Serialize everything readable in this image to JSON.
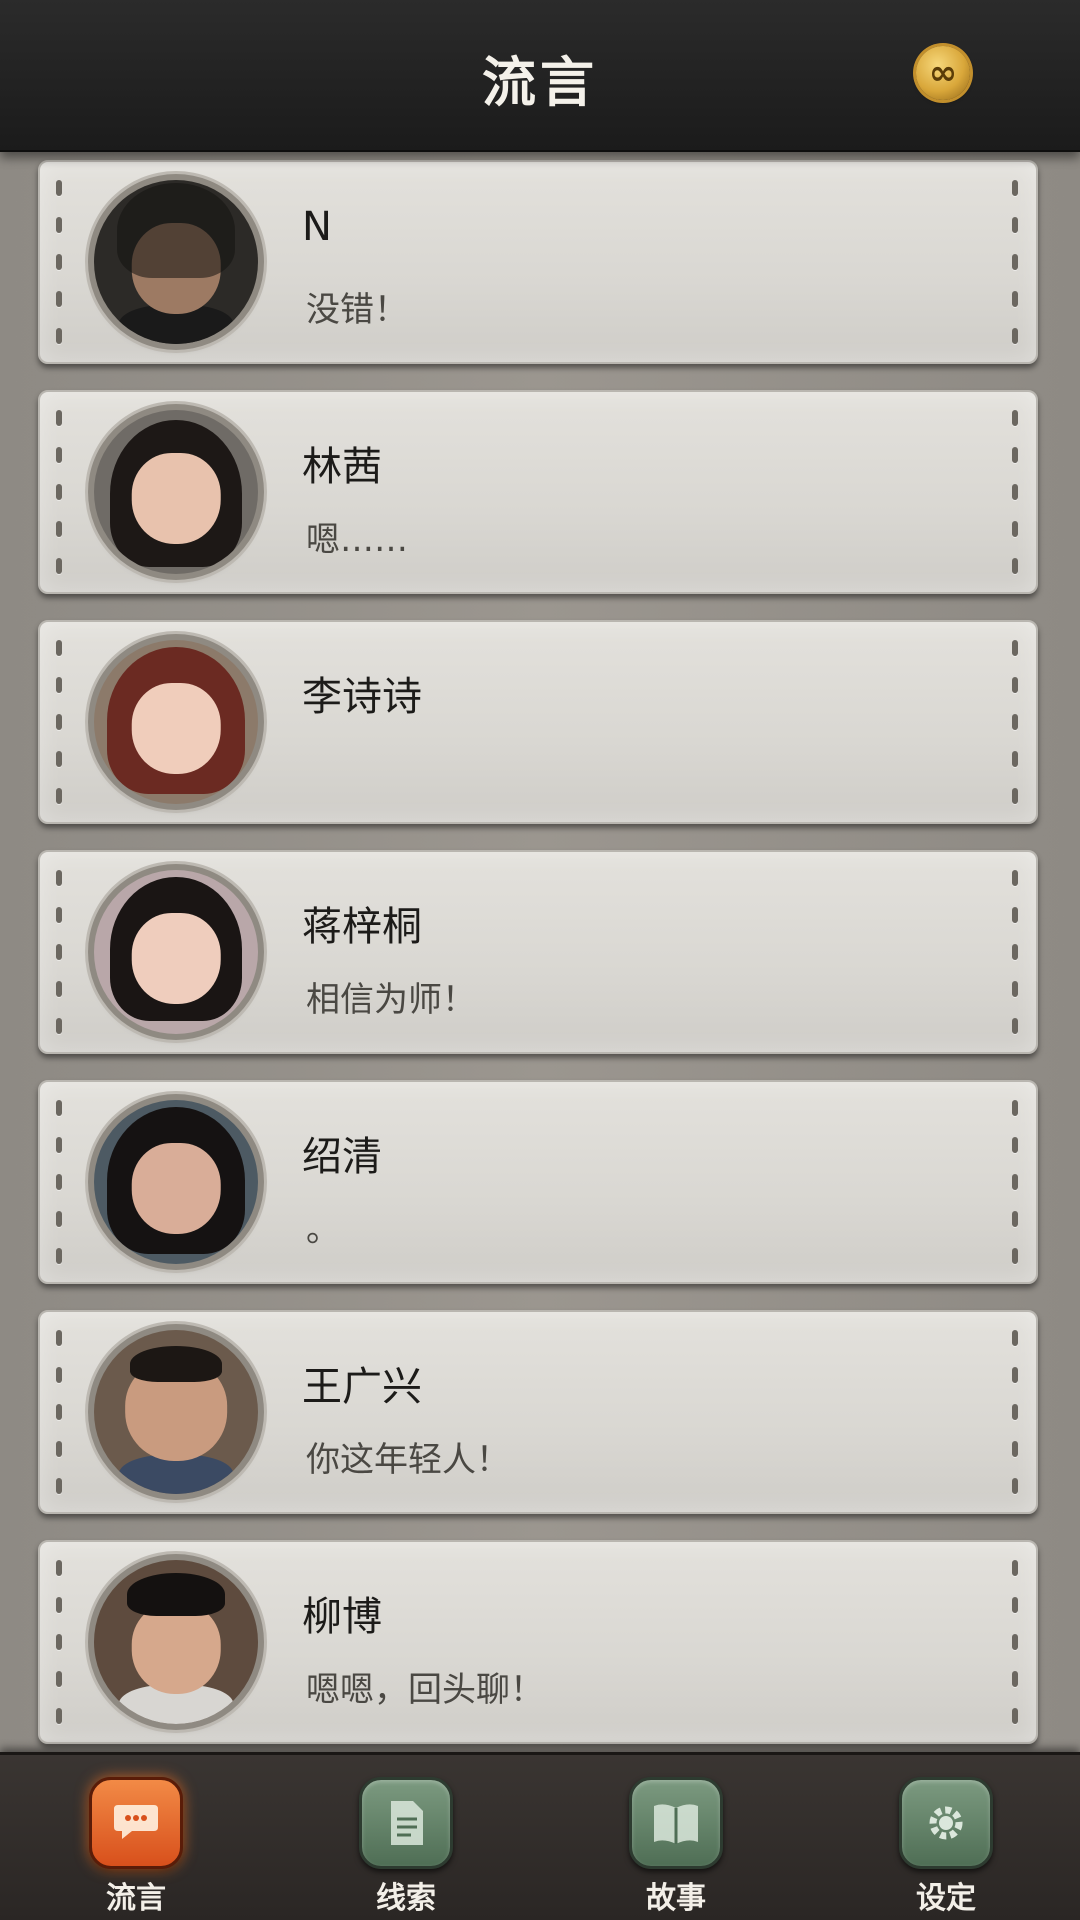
{
  "header": {
    "title": "流言",
    "coin_icon": "infinity-coin-icon",
    "coin_glyph": "∞"
  },
  "contacts": [
    {
      "name": "N",
      "message": "没错！"
    },
    {
      "name": "林茜",
      "message": "嗯……"
    },
    {
      "name": "李诗诗",
      "message": ""
    },
    {
      "name": "蒋梓桐",
      "message": "相信为师！"
    },
    {
      "name": "绍清",
      "message": "。"
    },
    {
      "name": "王广兴",
      "message": "你这年轻人！"
    },
    {
      "name": "柳博",
      "message": "嗯嗯，回头聊！"
    }
  ],
  "nav": {
    "items": [
      {
        "label": "流言",
        "icon": "chat-bubble-icon",
        "active": true
      },
      {
        "label": "线索",
        "icon": "document-icon",
        "active": false
      },
      {
        "label": "故事",
        "icon": "book-icon",
        "active": false
      },
      {
        "label": "设定",
        "icon": "gear-icon",
        "active": false
      }
    ]
  },
  "colors": {
    "header_bg": "#1f1f1f",
    "card_bg": "#dcdad5",
    "nav_active": "#e0642a",
    "nav_inactive": "#5f7f64"
  }
}
